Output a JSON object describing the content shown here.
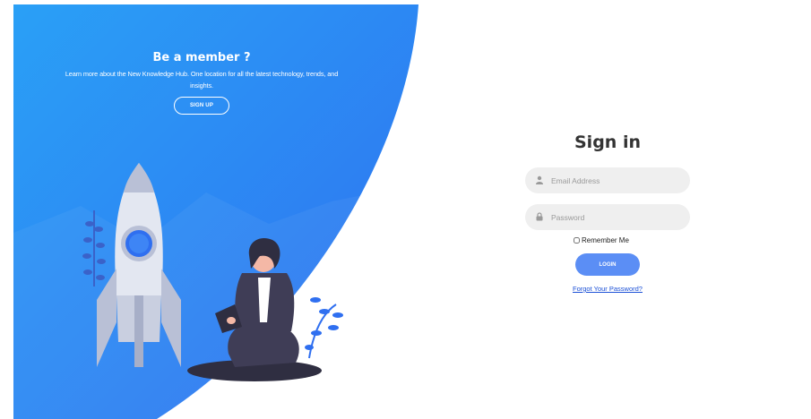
{
  "promo": {
    "title": "Be a member ?",
    "description": "Learn more about the New Knowledge Hub. One location for all the latest technology, trends, and insights.",
    "signup_label": "SIGN UP"
  },
  "signin": {
    "title": "Sign in",
    "email_placeholder": "Email Address",
    "password_placeholder": "Password",
    "remember_label": "Remember Me",
    "login_label": "LOGIN",
    "forgot_label": "Forgot Your Password?"
  },
  "colors": {
    "panel_blue": "#2f8cf5",
    "button_blue": "#5b8ef5",
    "link_blue": "#1a4fd6"
  }
}
